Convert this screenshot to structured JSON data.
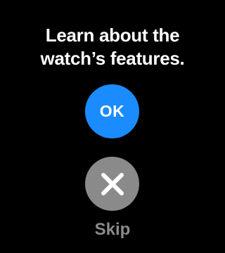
{
  "prompt": {
    "line1": "Learn about the",
    "line2": "watch’s features."
  },
  "ok_button": {
    "label": "OK",
    "color": "#1a8cff"
  },
  "skip_button": {
    "icon": "close-icon",
    "label": "Skip",
    "color": "#8a8a8a"
  },
  "colors": {
    "background": "#000000",
    "text": "#ffffff"
  }
}
